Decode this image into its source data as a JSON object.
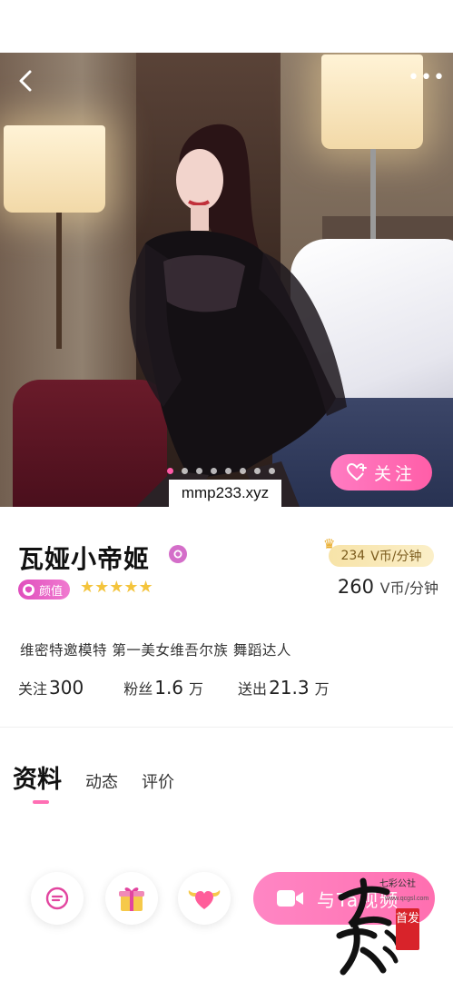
{
  "header": {
    "more_label": "•••"
  },
  "carousel": {
    "page_count": 8,
    "active_index": 0
  },
  "follow_button": {
    "label": "关注"
  },
  "overlay_url": "mmp233.xyz",
  "profile": {
    "name": "瓦娅小帝姬",
    "badge_label": "颜值",
    "rating": 5,
    "star_glyph": "★★★★★",
    "bio": "维密特邀模特 第一美女维吾尔族 舞蹈达人"
  },
  "rate": {
    "vip_price": "234",
    "vip_unit": "V币/分钟",
    "price": "260",
    "unit": "V币/分钟"
  },
  "stats": [
    {
      "label": "关注",
      "value": "300",
      "unit": ""
    },
    {
      "label": "粉丝",
      "value": "1.6",
      "unit": "万"
    },
    {
      "label": "送出",
      "value": "21.3",
      "unit": "万"
    }
  ],
  "tabs": [
    {
      "label": "资料",
      "active": true
    },
    {
      "label": "动态",
      "active": false
    },
    {
      "label": "评价",
      "active": false
    }
  ],
  "actions": {
    "video_label": "与Ta视频"
  },
  "watermark": {
    "brand": "七彩公社",
    "url": "www.qcgsl.com",
    "seal": "首发",
    "calligraphy": "七彩"
  },
  "colors": {
    "accent": "#ff6fb4",
    "star": "#f4c43c",
    "badge": "#e04fbd",
    "gold_pill": "#f7e3a8"
  }
}
